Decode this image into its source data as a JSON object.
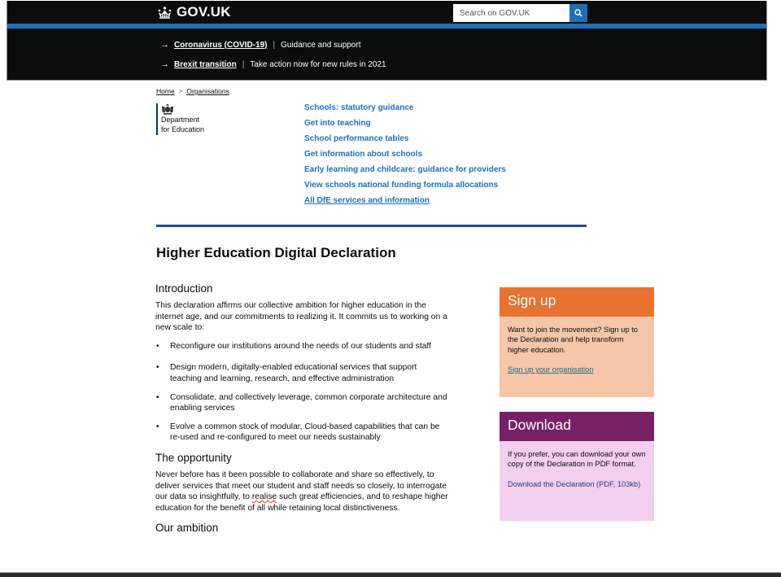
{
  "header": {
    "logo_text": "GOV.UK",
    "search": {
      "placeholder": "Search on GOV.UK"
    },
    "notices": [
      {
        "link": "Coronavirus (COVID-19)",
        "text": "Guidance and support"
      },
      {
        "link": "Brexit transition",
        "text": "Take action now for new rules in 2021"
      }
    ],
    "colors": {
      "background": "#0b0c0c",
      "accent": "#1d70b8"
    }
  },
  "breadcrumb": [
    {
      "label": "Home"
    },
    {
      "label": "Organisations"
    }
  ],
  "organisation": {
    "line1": "Department",
    "line2": "for Education"
  },
  "quick_links": [
    "Schools: statutory guidance",
    "Get into teaching",
    "School performance tables",
    "Get information about schools",
    "Early learning and childcare: guidance for providers",
    "View schools national funding formula allocations",
    "All DfE services and information"
  ],
  "page_title": "Higher Education Digital Declaration",
  "content": {
    "intro_heading": "Introduction",
    "intro_text": "This declaration affirms our collective ambition for higher education in the internet age, and our commitments to realizing it.  It commits us to working on a new scale to:",
    "commitments": [
      "Reconfigure our institutions around the needs of our students and staff",
      "Design modern, digitally-enabled educational services that support teaching and learning, research, and effective administration",
      "Consolidate, and collectively leverage, common corporate architecture and enabling services",
      "Evolve a common stock of modular, Cloud-based capabilities that can be re-used and re-configured to meet our needs sustainably"
    ],
    "opportunity_heading": "The opportunity",
    "opportunity_text_before": "Never before has it been possible to collaborate and share so effectively, to deliver services that meet our student and staff needs so closely, to interrogate our data so insightfully, to ",
    "opportunity_text_spell": "realise",
    "opportunity_text_after": " such great efficiencies, and to reshape higher education for the benefit of all while retaining local distinctiveness.",
    "ambition_heading": "Our ambition"
  },
  "signup_box": {
    "heading": "Sign up",
    "text": "Want to join the movement? Sign up to the Declaration and help transform higher education.",
    "link": "Sign up your organisation",
    "colors": {
      "header": "#e87230",
      "body": "#f6c6a8"
    }
  },
  "download_box": {
    "heading": "Download",
    "text": "If you prefer, you can download your own copy of the Declaration in PDF format.",
    "link": "Download the Declaration (PDF, 103kb)",
    "colors": {
      "header": "#782167",
      "body": "#f2cfef"
    }
  }
}
